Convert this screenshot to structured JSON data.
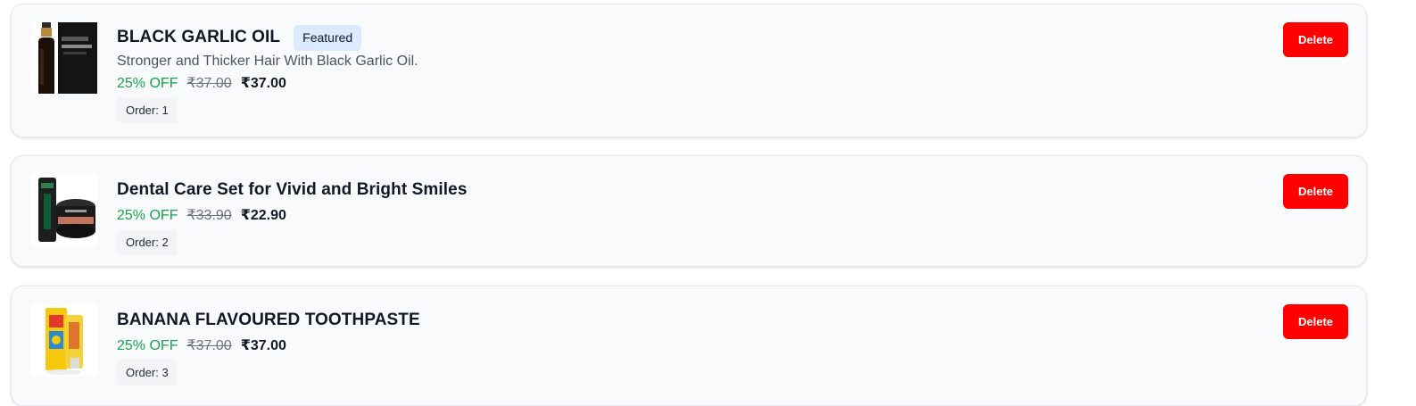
{
  "products": [
    {
      "title": "BLACK GARLIC OIL",
      "badge": "Featured",
      "description": "Stronger and Thicker Hair With Black Garlic Oil.",
      "discount": "25% OFF",
      "mrp": "₹37.00",
      "price": "₹37.00",
      "order": "Order: 1",
      "delete_label": "Delete",
      "image_icon": "garlic-oil-bottle-image"
    },
    {
      "title": "Dental Care Set for Vivid and Bright Smiles",
      "discount": "25% OFF",
      "mrp": "₹33.90",
      "price": "₹22.90",
      "order": "Order: 2",
      "delete_label": "Delete",
      "image_icon": "dental-care-set-image"
    },
    {
      "title": "BANANA FLAVOURED TOOTHPASTE",
      "discount": "25% OFF",
      "mrp": "₹37.00",
      "price": "₹37.00",
      "order": "Order: 3",
      "delete_label": "Delete",
      "image_icon": "banana-toothpaste-image"
    }
  ],
  "colors": {
    "discount": "#16a34a",
    "delete_button": "#ff0000",
    "badge_bg": "#dbeafe",
    "card_bg": "#f9fafb"
  }
}
